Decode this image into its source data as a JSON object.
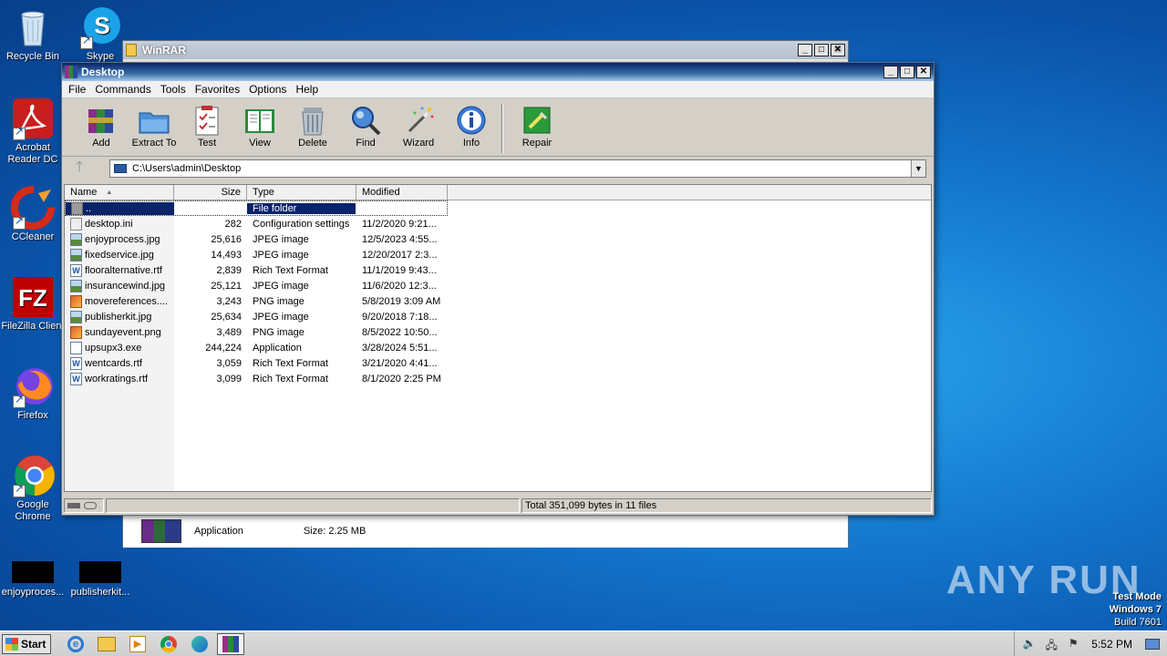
{
  "desktop": {
    "icons": [
      {
        "label": "Recycle Bin"
      },
      {
        "label": "Skype"
      },
      {
        "label": "Acrobat Reader DC"
      },
      {
        "label": "CCleaner"
      },
      {
        "label": "FileZilla Client"
      },
      {
        "label": "Firefox"
      },
      {
        "label": "Google Chrome"
      },
      {
        "label": "enjoyproces..."
      },
      {
        "label": "publisherkit..."
      }
    ]
  },
  "back_window": {
    "title": "WinRAR",
    "file_type": "Application",
    "file_size": "Size: 2.25 MB"
  },
  "main_window": {
    "title": "Desktop",
    "menu": [
      "File",
      "Commands",
      "Tools",
      "Favorites",
      "Options",
      "Help"
    ],
    "toolbar": [
      "Add",
      "Extract To",
      "Test",
      "View",
      "Delete",
      "Find",
      "Wizard",
      "Info",
      "Repair"
    ],
    "address": "C:\\Users\\admin\\Desktop",
    "columns": [
      "Name",
      "Size",
      "Type",
      "Modified"
    ],
    "files": [
      {
        "name": "..",
        "size": "",
        "type": "File folder",
        "modified": "",
        "icon": "folder-icon"
      },
      {
        "name": "desktop.ini",
        "size": "282",
        "type": "Configuration settings",
        "modified": "11/2/2020 9:21...",
        "icon": "ini-file-icon"
      },
      {
        "name": "enjoyprocess.jpg",
        "size": "25,616",
        "type": "JPEG image",
        "modified": "12/5/2023 4:55...",
        "icon": "jpeg-file-icon"
      },
      {
        "name": "fixedservice.jpg",
        "size": "14,493",
        "type": "JPEG image",
        "modified": "12/20/2017 2:3...",
        "icon": "jpeg-file-icon"
      },
      {
        "name": "flooralternative.rtf",
        "size": "2,839",
        "type": "Rich Text Format",
        "modified": "11/1/2019 9:43...",
        "icon": "rtf-file-icon"
      },
      {
        "name": "insurancewind.jpg",
        "size": "25,121",
        "type": "JPEG image",
        "modified": "11/6/2020 12:3...",
        "icon": "jpeg-file-icon"
      },
      {
        "name": "movereferences....",
        "size": "3,243",
        "type": "PNG image",
        "modified": "5/8/2019 3:09 AM",
        "icon": "png-file-icon"
      },
      {
        "name": "publisherkit.jpg",
        "size": "25,634",
        "type": "JPEG image",
        "modified": "9/20/2018 7:18...",
        "icon": "jpeg-file-icon"
      },
      {
        "name": "sundayevent.png",
        "size": "3,489",
        "type": "PNG image",
        "modified": "8/5/2022 10:50...",
        "icon": "png-file-icon"
      },
      {
        "name": "upsupx3.exe",
        "size": "244,224",
        "type": "Application",
        "modified": "3/28/2024 5:51...",
        "icon": "exe-file-icon"
      },
      {
        "name": "wentcards.rtf",
        "size": "3,059",
        "type": "Rich Text Format",
        "modified": "3/21/2020 4:41...",
        "icon": "rtf-file-icon"
      },
      {
        "name": "workratings.rtf",
        "size": "3,099",
        "type": "Rich Text Format",
        "modified": "8/1/2020 2:25 PM",
        "icon": "rtf-file-icon"
      }
    ],
    "status": "Total 351,099 bytes in 11 files"
  },
  "taskbar": {
    "start_label": "Start",
    "clock": "5:52 PM"
  },
  "watermark": "ANY RUN",
  "test_mode": {
    "line1": "Test Mode",
    "line2": "Windows 7",
    "line3": "Build 7601"
  },
  "colors": {
    "title_active": "#0a246a",
    "selection": "#0a246a",
    "desktop": "#1479cf"
  }
}
